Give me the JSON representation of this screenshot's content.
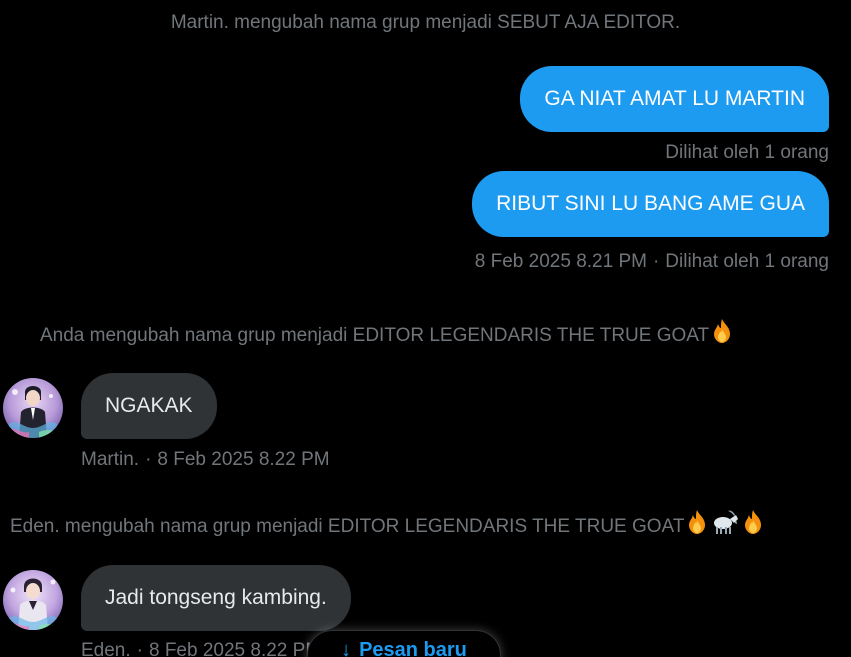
{
  "messages": {
    "system_1": "Martin. mengubah nama grup menjadi SEBUT AJA EDITOR.",
    "out_1": "GA NIAT AMAT LU MARTIN",
    "out_1_meta": "Dilihat oleh 1 orang",
    "out_2": "RIBUT SINI LU BANG AME GUA",
    "out_2_time": "8 Feb 2025 8.21 PM",
    "out_2_seen": "Dilihat oleh 1 orang",
    "system_2": "Anda mengubah nama grup menjadi EDITOR LEGENDARIS THE TRUE GOAT",
    "in_1": "NGAKAK",
    "in_1_sender": "Martin.",
    "in_1_time": "8 Feb 2025 8.22 PM",
    "system_3": "Eden. mengubah nama grup menjadi EDITOR LEGENDARIS THE TRUE GOAT",
    "in_2": "Jadi tongseng kambing.",
    "in_2_sender": "Eden.",
    "in_2_time": "8 Feb 2025 8.22 PM"
  },
  "separator": "·",
  "new_messages_pill": {
    "label": "Pesan baru",
    "icon": "arrow-down-icon"
  },
  "icons": {
    "fire": "fire-emoji-icon",
    "goat": "goat-emoji-icon"
  },
  "colors": {
    "background": "#000000",
    "outgoing_bubble": "#1d9bf0",
    "incoming_bubble": "#2f3336",
    "muted_text": "#71767b",
    "accent": "#1d9bf0"
  }
}
